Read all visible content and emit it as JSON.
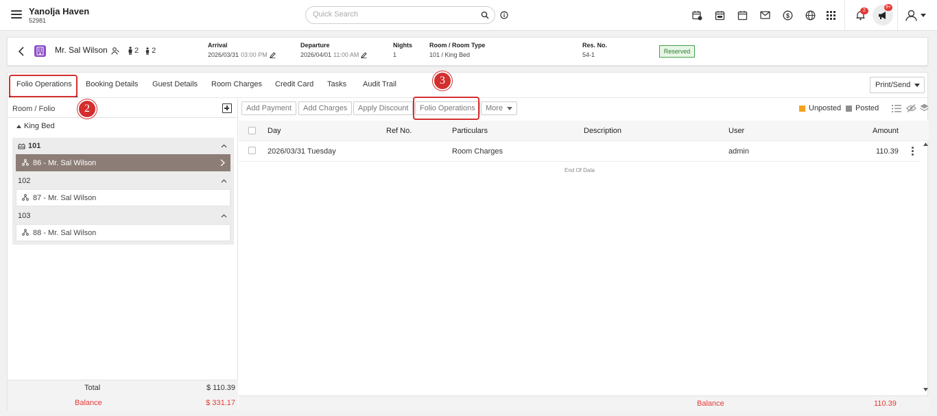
{
  "header": {
    "hotel_name": "Yanolja Haven",
    "hotel_code": "52981",
    "search_placeholder": "Quick Search",
    "notifications_badge": "2",
    "announcements_badge": "9+",
    "icons": [
      "menu-icon",
      "search-icon",
      "info-icon",
      "calendar-clock-icon",
      "calendar-day-icon",
      "calendar-icon",
      "mail-icon",
      "dollar-icon",
      "globe-icon",
      "apps-grid-icon",
      "bell-icon",
      "megaphone-icon",
      "user-icon"
    ]
  },
  "guest": {
    "name": "Mr. Sal Wilson",
    "adults": "2",
    "children": "2",
    "arrival_label": "Arrival",
    "arrival_date": "2026/03/31",
    "arrival_time": "03:00 PM",
    "departure_label": "Departure",
    "departure_date": "2026/04/01",
    "departure_time": "11:00 AM",
    "nights_label": "Nights",
    "nights": "1",
    "room_label": "Room / Room Type",
    "room": "101 / King Bed",
    "res_label": "Res. No.",
    "res_no": "54-1",
    "status": "Reserved"
  },
  "tabs": [
    "Folio Operations",
    "Booking Details",
    "Guest Details",
    "Room Charges",
    "Credit Card",
    "Tasks",
    "Audit Trail"
  ],
  "print_send": "Print/Send",
  "callouts": [
    "2",
    "3"
  ],
  "left_panel": {
    "title": "Room / Folio",
    "room_type": "King Bed",
    "rooms": [
      {
        "number": "101",
        "folio": "86 - Mr. Sal Wilson"
      },
      {
        "number": "102",
        "folio": "87 - Mr. Sal Wilson"
      },
      {
        "number": "103",
        "folio": "88 - Mr. Sal Wilson"
      }
    ],
    "total_label": "Total",
    "total_value": "$ 110.39",
    "balance_label": "Balance",
    "balance_value": "$ 331.17"
  },
  "toolbar": {
    "add_payment": "Add Payment",
    "add_charges": "Add Charges",
    "apply_discount": "Apply Discount",
    "folio_operations": "Folio Operations",
    "more": "More",
    "unposted": "Unposted",
    "posted": "Posted",
    "unposted_color": "#f5a21b",
    "posted_color": "#8d8d8d"
  },
  "table": {
    "columns": [
      "Day",
      "Ref No.",
      "Particulars",
      "Description",
      "User",
      "Amount"
    ],
    "rows": [
      {
        "day": "2026/03/31 Tuesday",
        "ref": "",
        "particulars": "Room Charges",
        "description": "",
        "user": "admin",
        "amount": "110.39"
      }
    ],
    "end_text": "End Of Data",
    "balance_label": "Balance",
    "balance_value": "110.39"
  }
}
